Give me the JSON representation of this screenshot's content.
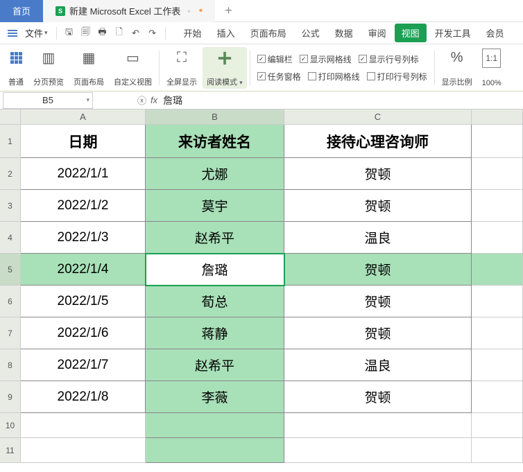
{
  "title_tabs": {
    "home": "首页",
    "doc": "新建 Microsoft Excel 工作表"
  },
  "file_menu": "文件",
  "menu_tabs": [
    "开始",
    "插入",
    "页面布局",
    "公式",
    "数据",
    "审阅",
    "视图",
    "开发工具",
    "会员"
  ],
  "active_menu": "视图",
  "ribbon": {
    "normal": "普通",
    "page_break": "分页预览",
    "page_layout": "页面布局",
    "custom_view": "自定义视图",
    "fullscreen": "全屏显示",
    "read_mode": "阅读模式",
    "checks": {
      "edit_bar": "编辑栏",
      "show_grid": "显示网格线",
      "show_rowcol": "显示行号列标",
      "task_pane": "任务窗格",
      "print_grid": "打印网格线",
      "print_rowcol": "打印行号列标"
    },
    "zoom_ratio": "显示比例",
    "zoom_100": "100%"
  },
  "name_box": "B5",
  "formula_value": "詹璐",
  "columns": [
    "A",
    "B",
    "C"
  ],
  "row_headers": [
    "1",
    "2",
    "3",
    "4",
    "5",
    "6",
    "7",
    "8",
    "9",
    "10",
    "11"
  ],
  "headers": {
    "A": "日期",
    "B": "来访者姓名",
    "C": "接待心理咨询师"
  },
  "data": [
    {
      "A": "2022/1/1",
      "B": "尤娜",
      "C": "贺顿"
    },
    {
      "A": "2022/1/2",
      "B": "莫宇",
      "C": "贺顿"
    },
    {
      "A": "2022/1/3",
      "B": "赵希平",
      "C": "温良"
    },
    {
      "A": "2022/1/4",
      "B": "詹璐",
      "C": "贺顿"
    },
    {
      "A": "2022/1/5",
      "B": "荀总",
      "C": "贺顿"
    },
    {
      "A": "2022/1/6",
      "B": "蒋静",
      "C": "贺顿"
    },
    {
      "A": "2022/1/7",
      "B": "赵希平",
      "C": "温良"
    },
    {
      "A": "2022/1/8",
      "B": "李薇",
      "C": "贺顿"
    }
  ],
  "selected_row_index": 3,
  "selected_col": "B"
}
